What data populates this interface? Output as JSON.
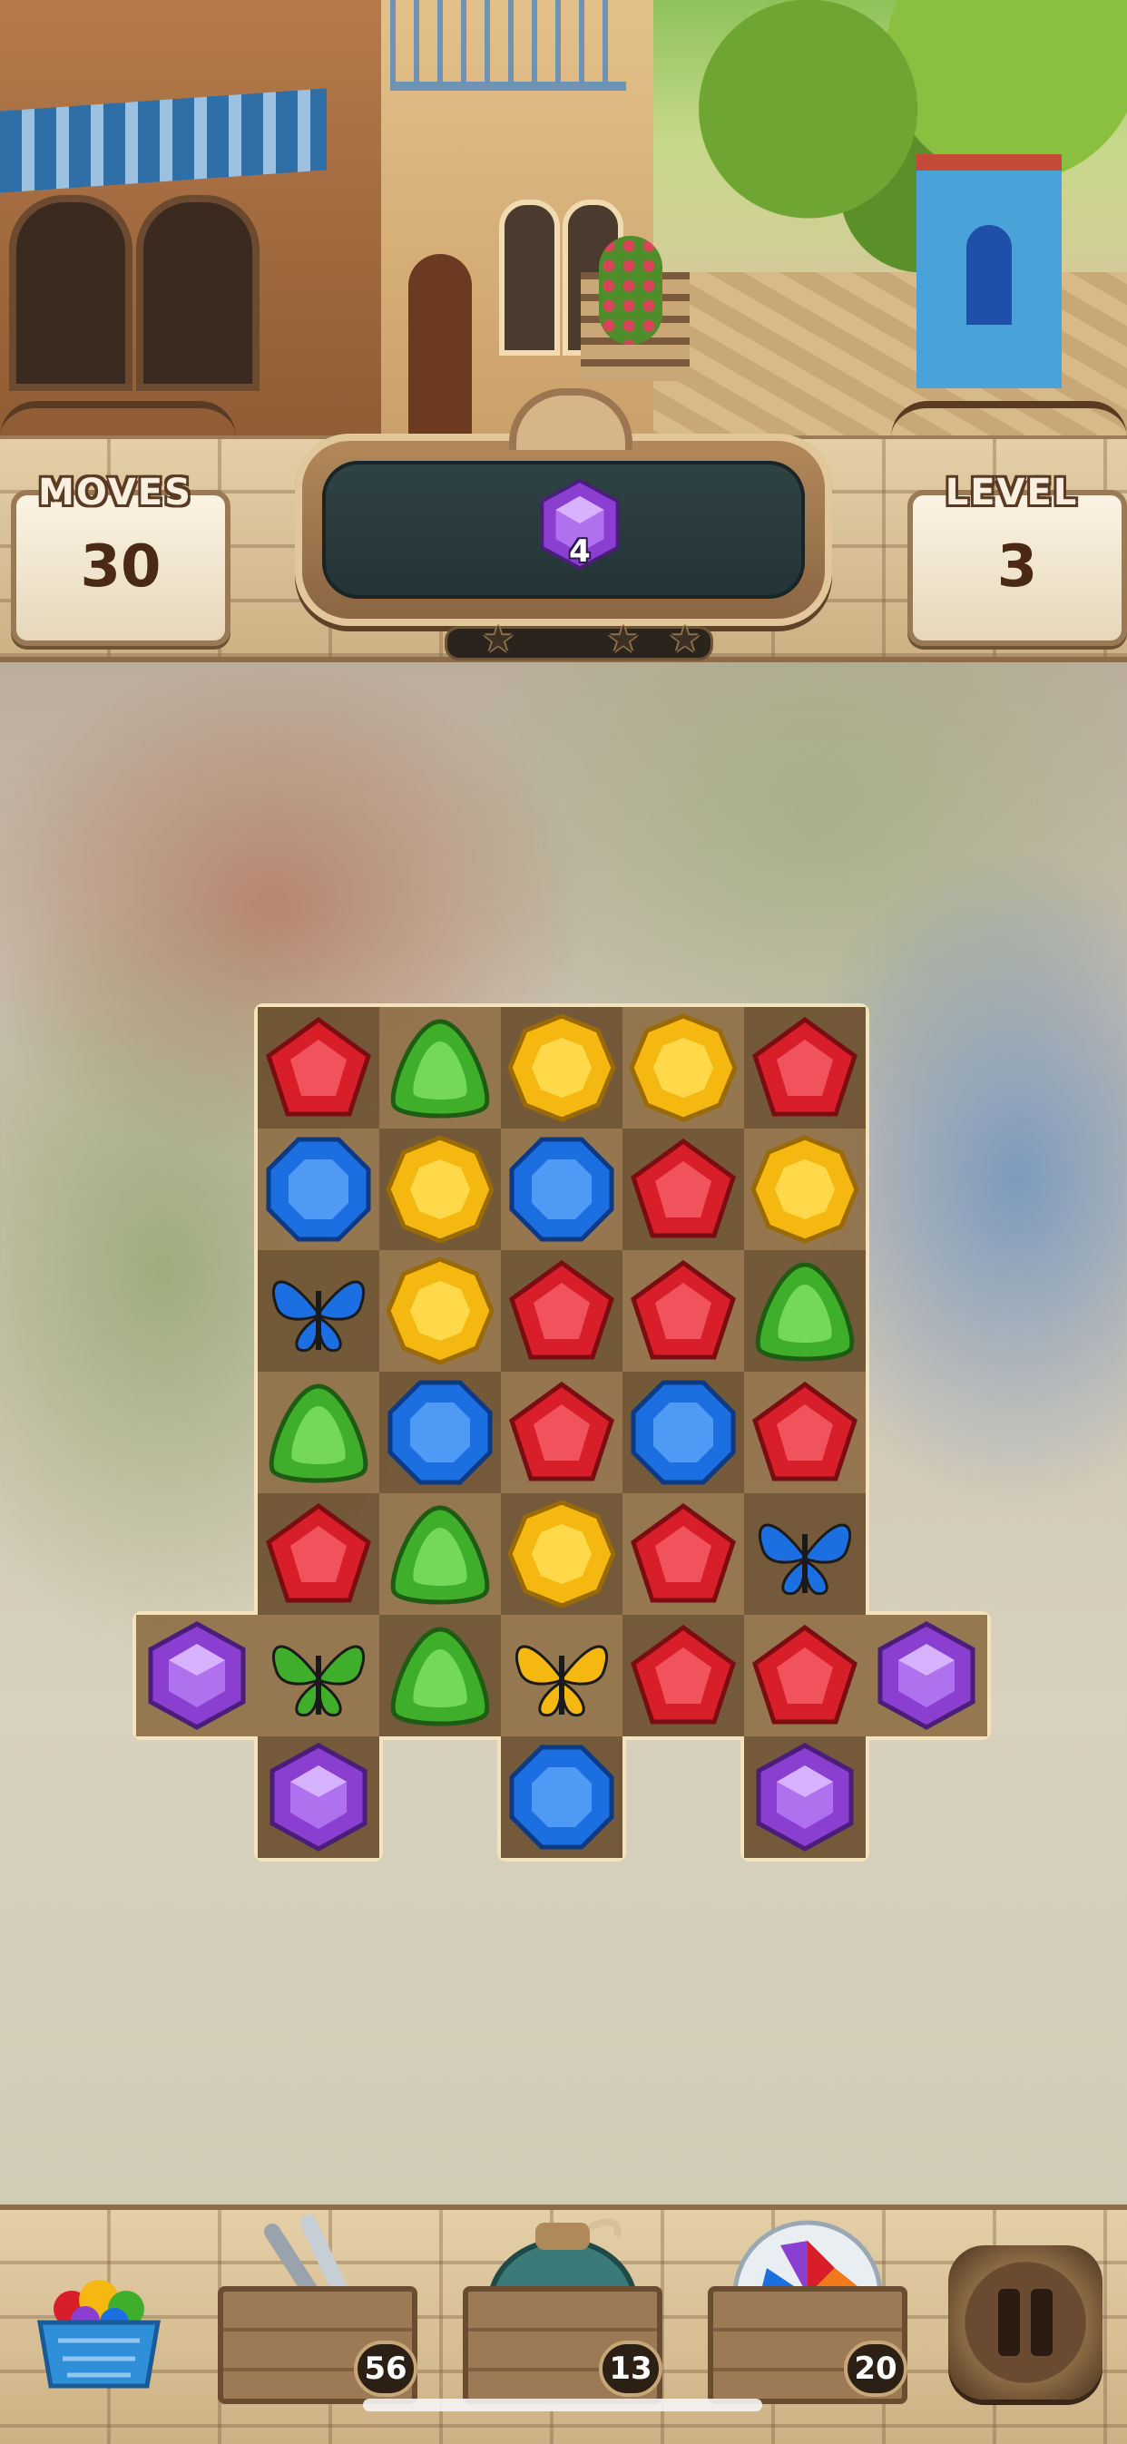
{
  "hud": {
    "moves_label": "MOVES",
    "moves_value": "30",
    "level_label": "LEVEL",
    "level_value": "3",
    "goal": {
      "gem": "purple",
      "count": "4"
    },
    "stars": 3,
    "stars_earned": 0
  },
  "board": {
    "grid": [
      [
        "red",
        "green",
        "yellow",
        "yellow",
        "red",
        null,
        null
      ],
      [
        "blue",
        "yellow",
        "blue",
        "red",
        "yellow",
        null,
        null
      ],
      [
        "butterfly-blue",
        "yellow",
        "red",
        "red",
        "green",
        null,
        null
      ],
      [
        "green",
        "blue",
        "red",
        "blue",
        "red",
        null,
        null
      ],
      [
        "red",
        "green",
        "yellow",
        "red",
        "butterfly-blue",
        null,
        null
      ],
      [
        "butterfly-green",
        "green",
        "butterfly-yellow",
        "red",
        "red",
        null,
        null
      ],
      [
        "purple",
        null,
        "blue",
        null,
        "purple",
        null,
        null
      ]
    ],
    "row6_left": "purple",
    "row6_right": "purple"
  },
  "boosters": [
    {
      "name": "tongs",
      "count": "56"
    },
    {
      "name": "bomb-jar",
      "count": "13"
    },
    {
      "name": "color-orb",
      "count": "20"
    }
  ],
  "colors": {
    "red": "#d81e28",
    "green": "#3fae2a",
    "yellow": "#f5b811",
    "blue": "#1c6fe0",
    "purple": "#8a3fd1"
  },
  "icons": {
    "shop": "gem-basket-icon",
    "pause": "pause-icon",
    "star": "star-icon"
  }
}
